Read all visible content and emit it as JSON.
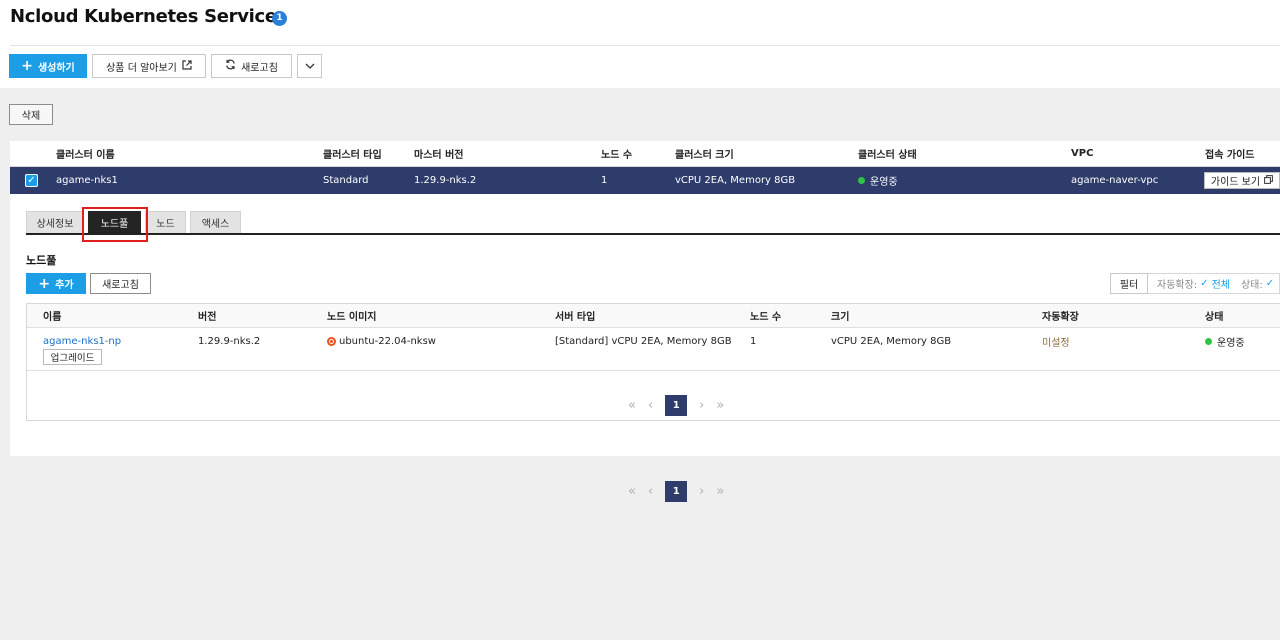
{
  "header": {
    "title": "Ncloud Kubernetes Service",
    "info_badge": "1",
    "buttons": {
      "create": "생성하기",
      "learn_more": "상품 더 알아보기",
      "refresh": "새로고침"
    }
  },
  "toolbar": {
    "delete_label": "삭제"
  },
  "cluster_table": {
    "columns": [
      "클러스터 이름",
      "클러스터 타입",
      "마스터 버전",
      "노드 수",
      "클러스터 크기",
      "클러스터 상태",
      "VPC",
      "접속 가이드"
    ],
    "row": {
      "name": "agame-nks1",
      "type": "Standard",
      "master_version": "1.29.9-nks.2",
      "node_count": "1",
      "size": "vCPU 2EA, Memory 8GB",
      "status": "운영중",
      "vpc": "agame-naver-vpc",
      "guide_label": "가이드 보기"
    }
  },
  "detail_tabs": [
    "상세정보",
    "노드풀",
    "노드",
    "액세스"
  ],
  "active_tab": "노드풀",
  "nodepool_section": {
    "title": "노드풀",
    "add_label": "추가",
    "refresh_label": "새로고침",
    "filter_label": "필터",
    "filter_autoscale_label": "자동확장:",
    "filter_autoscale_value": "전체",
    "filter_status_label": "상태:"
  },
  "nodepool_table": {
    "columns": [
      "이름",
      "버전",
      "노드 이미지",
      "서버 타입",
      "노드 수",
      "크기",
      "자동확장",
      "상태"
    ],
    "row": {
      "name": "agame-nks1-np",
      "upgrade_label": "업그레이드",
      "version": "1.29.9-nks.2",
      "image": "ubuntu-22.04-nksw",
      "server_type": "[Standard] vCPU 2EA, Memory 8GB",
      "node_count": "1",
      "size": "vCPU 2EA, Memory 8GB",
      "autoscale": "미설정",
      "status": "운영중"
    }
  },
  "pagination": {
    "inner_page": "1",
    "outer_page": "1"
  },
  "colors": {
    "primary": "#1c9ee6",
    "selected_row": "#2e3c6b",
    "status_running": "#2ec443",
    "highlight": "#e02020"
  }
}
